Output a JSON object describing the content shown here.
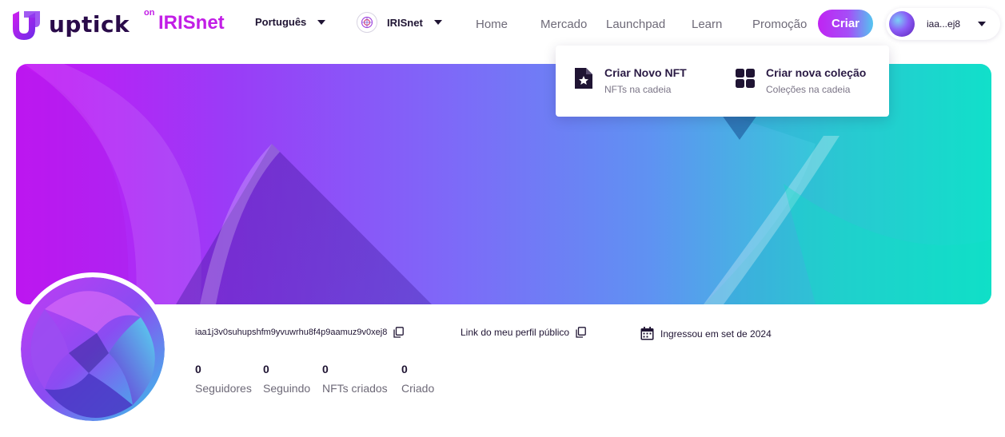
{
  "header": {
    "logo": {
      "word": "uptick",
      "on": "on",
      "net": "IRISnet"
    },
    "language": "Português",
    "chain": "IRISnet",
    "nav": [
      "Home",
      "Mercado",
      "Launchpad",
      "Learn",
      "Promoção"
    ],
    "create_label": "Criar",
    "account_short": "iaa...ej8"
  },
  "create_menu": {
    "items": [
      {
        "title": "Criar Novo NFT",
        "subtitle": "NFTs na cadeia",
        "icon": "file-star-icon"
      },
      {
        "title": "Criar nova coleção",
        "subtitle": "Coleções na cadeia",
        "icon": "grid-icon"
      }
    ]
  },
  "profile": {
    "address": "iaa1j3v0suhupshfm9yvuwrhu8f4p9aamuz9v0xej8",
    "public_link": "Link do meu perfil público",
    "joined": "Ingressou em set de 2024",
    "stats": [
      {
        "value": "0",
        "label": "Seguidores"
      },
      {
        "value": "0",
        "label": "Seguindo"
      },
      {
        "value": "0",
        "label": "NFTs criados"
      },
      {
        "value": "0",
        "label": "Criado"
      }
    ]
  },
  "colors": {
    "brand_purple": "#c21ee6",
    "dark_text": "#1f1433",
    "muted_text": "#6e6a78",
    "banner_start": "#c514f5",
    "banner_end": "#0ff0cb"
  }
}
